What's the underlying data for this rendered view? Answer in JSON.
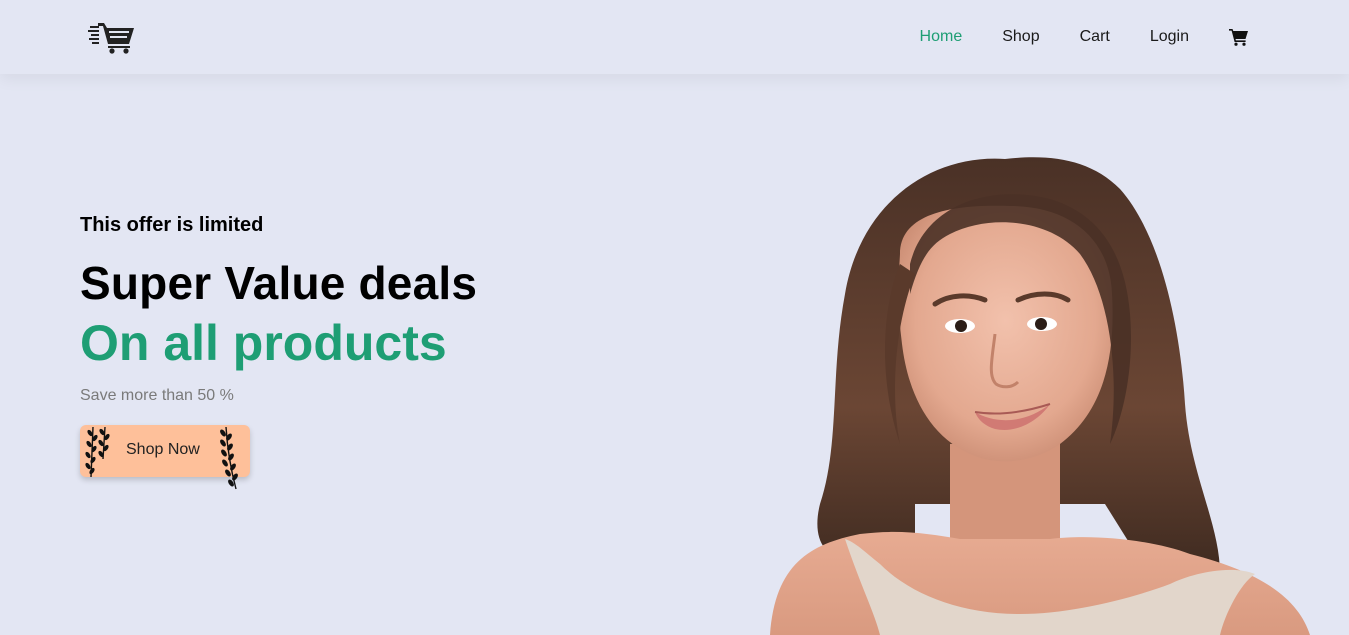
{
  "header": {
    "logo_icon": "shopping-cart-fast-icon",
    "nav": [
      {
        "label": "Home",
        "active": true
      },
      {
        "label": "Shop",
        "active": false
      },
      {
        "label": "Cart",
        "active": false
      },
      {
        "label": "Login",
        "active": false
      }
    ],
    "cart_icon": "cart-icon"
  },
  "hero": {
    "eyebrow": "This offer is limited",
    "headline": "Super Value deals",
    "headline_accent": "On all products",
    "subtext": "Save more than 50 %",
    "button_label": "Shop Now",
    "image": "smiling-woman-portrait"
  },
  "colors": {
    "background": "#e3e6f3",
    "accent": "#1e9e74",
    "button": "#fec09a"
  }
}
